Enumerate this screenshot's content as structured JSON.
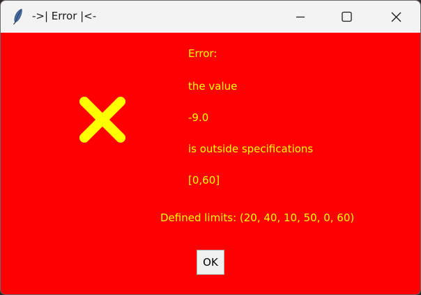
{
  "window": {
    "title": "->| Error |<-",
    "app_icon": "feather-icon",
    "controls": {
      "minimize_icon": "minimize-icon",
      "maximize_icon": "maximize-icon",
      "close_icon": "close-icon"
    }
  },
  "dialog": {
    "background_color": "#ff0000",
    "text_color": "#ffff00",
    "icon": "error-x-icon",
    "icon_color": "#ffff00",
    "message_lines": [
      "Error:",
      "the value",
      "-9.0",
      "is outside specifications",
      "[0,60]"
    ],
    "limits_text": "Defined limits: (20, 40, 10, 50, 0, 60)",
    "ok_label": "OK"
  }
}
